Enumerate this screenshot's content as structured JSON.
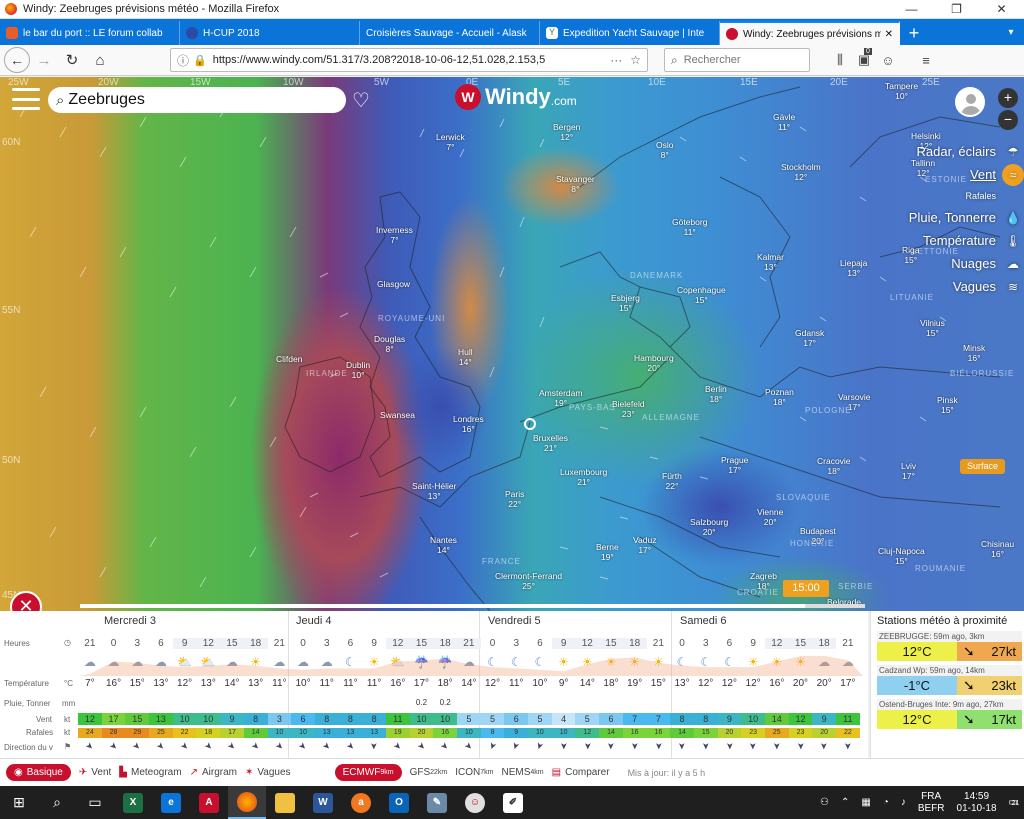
{
  "window": {
    "title": "Windy: Zeebruges prévisions météo - Mozilla Firefox"
  },
  "tabs": [
    {
      "label": "le bar du port :: LE forum collab",
      "color": "#e85d2a"
    },
    {
      "label": "H-CUP 2018",
      "color": "#2b4aa3"
    },
    {
      "label": "Croisières Sauvage - Accueil - Alask",
      "color": "#777777"
    },
    {
      "label": "Expedition Yacht Sauvage | Inte",
      "color": "#3a7a3a"
    },
    {
      "label": "Windy: Zeebruges prévisions m",
      "color": "#c8102e",
      "active": true
    }
  ],
  "nav": {
    "url": "https://www.windy.com/51.317/3.208?2018-10-06-12,51.028,2.153,5",
    "search_placeholder": "Rechercher",
    "badge": "0"
  },
  "map": {
    "search_value": "Zeebruges",
    "logo_text": "Windy",
    "logo_domain": ".com",
    "longitudes": [
      "25W",
      "20W",
      "15W",
      "10W",
      "5W",
      "0E",
      "5E",
      "10E",
      "15E",
      "20E",
      "25E"
    ],
    "latitudes": [
      "60N",
      "55N",
      "50N",
      "45N"
    ],
    "cities": [
      {
        "n": "Tampere",
        "t": "10°"
      },
      {
        "n": "Helsinki",
        "t": "12°"
      },
      {
        "n": "Tallinn",
        "t": "12°"
      },
      {
        "n": "Gävle",
        "t": "11°"
      },
      {
        "n": "Stockholm",
        "t": "12°"
      },
      {
        "n": "Bergen",
        "t": "12°"
      },
      {
        "n": "Oslo",
        "t": "8°"
      },
      {
        "n": "Lerwick",
        "t": "7°"
      },
      {
        "n": "Stavanger",
        "t": "8°"
      },
      {
        "n": "Göteborg",
        "t": "11°"
      },
      {
        "n": "Kalmar",
        "t": "13°"
      },
      {
        "n": "Liepaja",
        "t": "13°"
      },
      {
        "n": "Riga",
        "t": "15°"
      },
      {
        "n": "Inverness",
        "t": "7°"
      },
      {
        "n": "Glasgow",
        "t": ""
      },
      {
        "n": "Esbjerg",
        "t": "15°"
      },
      {
        "n": "Copenhague",
        "t": "15°"
      },
      {
        "n": "Gdansk",
        "t": "17°"
      },
      {
        "n": "Vilnius",
        "t": "15°"
      },
      {
        "n": "Douglas",
        "t": "8°"
      },
      {
        "n": "Dublin",
        "t": "10°"
      },
      {
        "n": "Clifden",
        "t": ""
      },
      {
        "n": "Hull",
        "t": "14°"
      },
      {
        "n": "Hambourg",
        "t": "20°"
      },
      {
        "n": "Minsk",
        "t": "16°"
      },
      {
        "n": "Amsterdam",
        "t": "19°"
      },
      {
        "n": "Bielefeld",
        "t": "23°"
      },
      {
        "n": "Berlin",
        "t": "18°"
      },
      {
        "n": "Poznan",
        "t": "18°"
      },
      {
        "n": "Varsovie",
        "t": "17°"
      },
      {
        "n": "Pinsk",
        "t": "15°"
      },
      {
        "n": "Swansea",
        "t": ""
      },
      {
        "n": "Londres",
        "t": "16°"
      },
      {
        "n": "Bruxelles",
        "t": "21°"
      },
      {
        "n": "Luxembourg",
        "t": "21°"
      },
      {
        "n": "Prague",
        "t": "17°"
      },
      {
        "n": "Cracovie",
        "t": "18°"
      },
      {
        "n": "Lviv",
        "t": "17°"
      },
      {
        "n": "Saint-Hélier",
        "t": "13°"
      },
      {
        "n": "Paris",
        "t": "22°"
      },
      {
        "n": "Fürth",
        "t": "22°"
      },
      {
        "n": "Vienne",
        "t": "20°"
      },
      {
        "n": "Salzbourg",
        "t": "20°"
      },
      {
        "n": "Budapest",
        "t": "20°"
      },
      {
        "n": "Nantes",
        "t": "14°"
      },
      {
        "n": "Berne",
        "t": "19°"
      },
      {
        "n": "Vaduz",
        "t": "17°"
      },
      {
        "n": "Cluj-Napoca",
        "t": "15°"
      },
      {
        "n": "Chisinau",
        "t": "16°"
      },
      {
        "n": "Clermont-Ferrand",
        "t": "25°"
      },
      {
        "n": "Zagreb",
        "t": "18°"
      },
      {
        "n": "Belgrade",
        "t": ""
      }
    ],
    "countries": [
      "ROYAUME-UNI",
      "IRLANDE",
      "ALLEMAGNE",
      "POLOGNE",
      "FRANCE",
      "DANEMARK",
      "LITUANIE",
      "BIÉLORUSSIE",
      "LETTONIE",
      "ESTONIE",
      "SLOVAQUIE",
      "HONGRIE",
      "ROUMANIE",
      "CROATIE",
      "SERBIE",
      "PAYS-BAS"
    ],
    "layers": [
      {
        "label": "Radar, éclairs",
        "icon": "radar-icon"
      },
      {
        "label": "Vent",
        "icon": "wind-icon",
        "active": true
      },
      {
        "label": "Rafales",
        "icon": "",
        "small": true
      },
      {
        "label": "Pluie, Tonnerre",
        "icon": "rain-icon"
      },
      {
        "label": "Température",
        "icon": "thermometer-icon"
      },
      {
        "label": "Nuages",
        "icon": "cloud-icon"
      },
      {
        "label": "Vagues",
        "icon": "waves-icon"
      }
    ],
    "surface": "Surface",
    "time_badge": "15:00"
  },
  "forecast": {
    "days": [
      "Mercredi 3",
      "Jeudi 4",
      "Vendredi 5",
      "Samedi 6"
    ],
    "labels": {
      "hours": "Heures",
      "temp": "Température",
      "temp_unit": "°C",
      "rain": "Pluie, Tonner",
      "rain_unit": "mm",
      "wind": "Vent",
      "wind_unit": "kt",
      "gust": "Rafales",
      "gust_unit": "kt",
      "dir": "Direction du v"
    },
    "hours": [
      "21",
      "0",
      "3",
      "6",
      "9",
      "12",
      "15",
      "18",
      "21",
      "0",
      "3",
      "6",
      "9",
      "12",
      "15",
      "18",
      "21",
      "0",
      "3",
      "6",
      "9",
      "12",
      "15",
      "18",
      "21",
      "0",
      "3",
      "6",
      "9",
      "12",
      "15",
      "18",
      "21"
    ],
    "icons": [
      "☁",
      "☁",
      "☁",
      "☁",
      "⛅",
      "⛅",
      "☁",
      "☀",
      "☁",
      "☁",
      "☁",
      "☾",
      "☀",
      "⛅",
      "☔",
      "☔",
      "☁",
      "☾",
      "☾",
      "☾",
      "☀",
      "☀",
      "☀",
      "☀",
      "☀",
      "☾",
      "☾",
      "☾",
      "☀",
      "☀",
      "☀",
      "☁",
      "☁"
    ],
    "temps": [
      "7°",
      "16°",
      "15°",
      "13°",
      "12°",
      "13°",
      "14°",
      "13°",
      "11°",
      "10°",
      "11°",
      "11°",
      "11°",
      "16°",
      "17°",
      "18°",
      "14°",
      "12°",
      "11°",
      "10°",
      "9°",
      "14°",
      "18°",
      "19°",
      "15°",
      "13°",
      "12°",
      "12°",
      "12°",
      "16°",
      "20°",
      "20°",
      "17°"
    ],
    "rain": [
      "",
      "",
      "",
      "",
      "",
      "",
      "",
      "",
      "",
      "",
      "",
      "",
      "",
      "",
      "0.2",
      "0.2",
      "",
      "",
      "",
      "",
      "",
      "",
      "",
      "",
      "",
      "",
      "",
      "",
      "",
      "",
      "",
      "",
      ""
    ],
    "wind": [
      "12",
      "17",
      "15",
      "13",
      "10",
      "10",
      "9",
      "8",
      "3",
      "6",
      "8",
      "8",
      "8",
      "11",
      "10",
      "10",
      "5",
      "5",
      "6",
      "5",
      "4",
      "5",
      "6",
      "7",
      "7",
      "8",
      "8",
      "9",
      "10",
      "14",
      "12",
      "9",
      "11"
    ],
    "wind_colors": [
      "#3cc43c",
      "#7ad33a",
      "#5fcb3a",
      "#3cc43c",
      "#3dbd8e",
      "#3dbd8e",
      "#3db6c3",
      "#3ab0d8",
      "#7cc7f0",
      "#49b9f0",
      "#3ab0d8",
      "#3ab0d8",
      "#3ab0d8",
      "#3cc43c",
      "#3dbd8e",
      "#3dbd8e",
      "#9fd6f5",
      "#9fd6f5",
      "#7cc7f0",
      "#9fd6f5",
      "#c6e6f8",
      "#9fd6f5",
      "#7cc7f0",
      "#49b9f0",
      "#49b9f0",
      "#3ab0d8",
      "#3ab0d8",
      "#3db6c3",
      "#3dbd8e",
      "#5fcb3a",
      "#3cc43c",
      "#3db6c3",
      "#3cc43c"
    ],
    "gust": [
      "24",
      "28",
      "29",
      "25",
      "22",
      "18",
      "17",
      "14",
      "10",
      "10",
      "13",
      "13",
      "13",
      "19",
      "20",
      "16",
      "10",
      "8",
      "9",
      "10",
      "10",
      "12",
      "14",
      "16",
      "16",
      "14",
      "15",
      "20",
      "23",
      "25",
      "23",
      "20",
      "22"
    ],
    "gust_colors": [
      "#e8a820",
      "#e88a20",
      "#e88a20",
      "#e8a820",
      "#e8c020",
      "#d8d020",
      "#b8d030",
      "#5fcb3a",
      "#3db6c3",
      "#3db6c3",
      "#3ab0d8",
      "#3ab0d8",
      "#3ab0d8",
      "#9ad030",
      "#b8d030",
      "#7ad33a",
      "#3db6c3",
      "#49b9f0",
      "#3ab0d8",
      "#3db6c3",
      "#3db6c3",
      "#3dbd8e",
      "#5fcb3a",
      "#7ad33a",
      "#7ad33a",
      "#5fcb3a",
      "#7ad33a",
      "#b8d030",
      "#d8d020",
      "#e8a820",
      "#d8d020",
      "#b8d030",
      "#e8c020"
    ],
    "dirs": [
      135,
      135,
      135,
      135,
      135,
      135,
      135,
      135,
      135,
      135,
      135,
      135,
      180,
      135,
      135,
      135,
      135,
      200,
      200,
      200,
      180,
      180,
      180,
      180,
      180,
      180,
      180,
      180,
      180,
      180,
      180,
      180,
      180
    ]
  },
  "stations": {
    "title": "Stations météo à proximité",
    "items": [
      {
        "name": "ZEEBRUGGE: 59m ago, 3km",
        "temp": "12°C",
        "temp_color": "#eef04a",
        "wind": "27kt",
        "wind_color": "#f0a850"
      },
      {
        "name": "Cadzand Wp: 59m ago, 14km",
        "temp": "-1°C",
        "temp_color": "#8fd0f0",
        "wind": "23kt",
        "wind_color": "#f0d070"
      },
      {
        "name": "Ostend-Bruges Inte: 9m ago, 27km",
        "temp": "12°C",
        "temp_color": "#eef04a",
        "wind": "17kt",
        "wind_color": "#90e070"
      }
    ]
  },
  "bottom": {
    "basique": "Basique",
    "vent": "Vent",
    "meteogram": "Meteogram",
    "airgram": "Airgram",
    "vagues": "Vagues",
    "ecmwf": "ECMWF",
    "ecmwf_sub": "9km",
    "gfs": "GFS",
    "gfs_sub": "22km",
    "icon": "ICON",
    "icon_sub": "7km",
    "nems": "NEMS",
    "nems_sub": "4km",
    "comparer": "Comparer",
    "updated": "Mis à jour: il y a 5 h"
  },
  "taskbar": {
    "lang1": "FRA",
    "lang2": "BEFR",
    "time": "14:59",
    "date": "01-10-18",
    "notif": "21"
  }
}
